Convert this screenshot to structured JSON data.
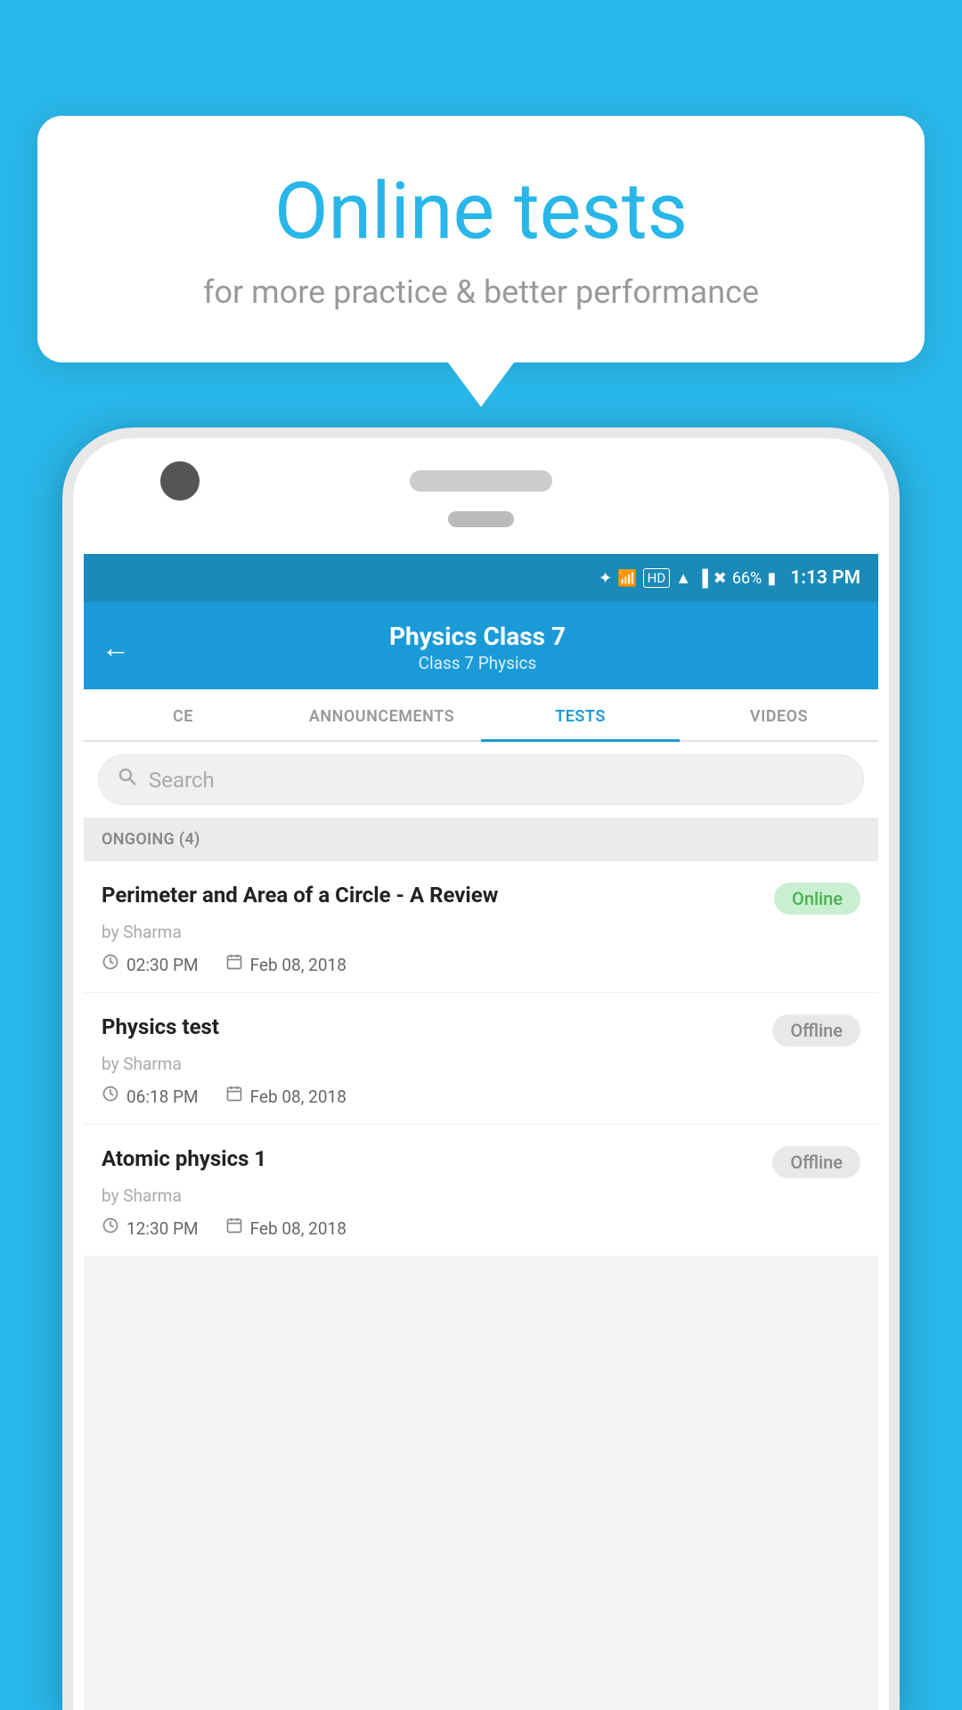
{
  "hero": {
    "title": "Online tests",
    "subtitle": "for more practice & better performance"
  },
  "status_bar": {
    "battery": "66%",
    "time": "1:13 PM"
  },
  "header": {
    "title": "Physics Class 7",
    "breadcrumb": "Class 7   Physics",
    "back_label": "←"
  },
  "tabs": [
    {
      "id": "ce",
      "label": "CE",
      "active": false
    },
    {
      "id": "announcements",
      "label": "ANNOUNCEMENTS",
      "active": false
    },
    {
      "id": "tests",
      "label": "TESTS",
      "active": true
    },
    {
      "id": "videos",
      "label": "VIDEOS",
      "active": false
    }
  ],
  "search": {
    "placeholder": "Search"
  },
  "section": {
    "label": "ONGOING (4)"
  },
  "tests": [
    {
      "name": "Perimeter and Area of a Circle - A Review",
      "author": "by Sharma",
      "time": "02:30 PM",
      "date": "Feb 08, 2018",
      "status": "Online",
      "status_type": "online"
    },
    {
      "name": "Physics test",
      "author": "by Sharma",
      "time": "06:18 PM",
      "date": "Feb 08, 2018",
      "status": "Offline",
      "status_type": "offline"
    },
    {
      "name": "Atomic physics 1",
      "author": "by Sharma",
      "time": "12:30 PM",
      "date": "Feb 08, 2018",
      "status": "Offline",
      "status_type": "offline"
    }
  ]
}
